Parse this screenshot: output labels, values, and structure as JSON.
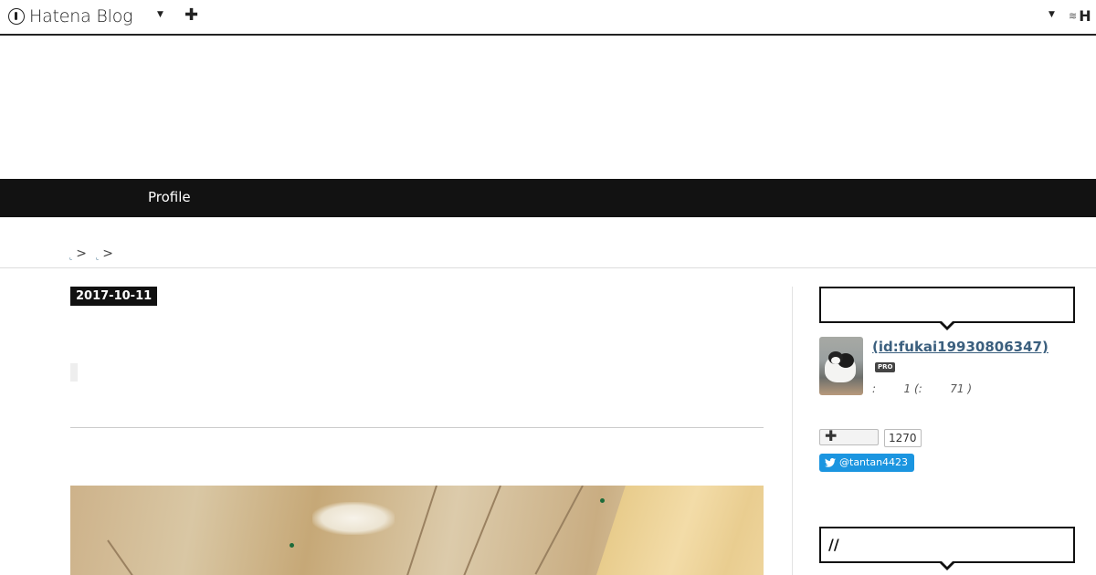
{
  "topbar": {
    "logo_text": "Hatena Blog",
    "blog_menu_icon": "caret-down-icon",
    "add_icon": "plus-icon",
    "user_menu_icon": "caret-down-icon",
    "user_brand_text": "H"
  },
  "globalnav": {
    "profile_label": "Profile"
  },
  "breadcrumb": {
    "sep1": ">",
    "sep2": ">"
  },
  "entry": {
    "date": "2017-10-11"
  },
  "sidebar": {
    "profile_name": " (id:fukai19930806347)",
    "pro_badge": "PRO",
    "stats_text": ":        1 (:        71 )",
    "follow_count": "1270",
    "twitter_handle": "@tantan4423",
    "module2_title": "//"
  },
  "colors": {
    "nav_bg": "#121212",
    "twitter_blue": "#1b95e0",
    "link_blue": "#3b5f7e"
  }
}
